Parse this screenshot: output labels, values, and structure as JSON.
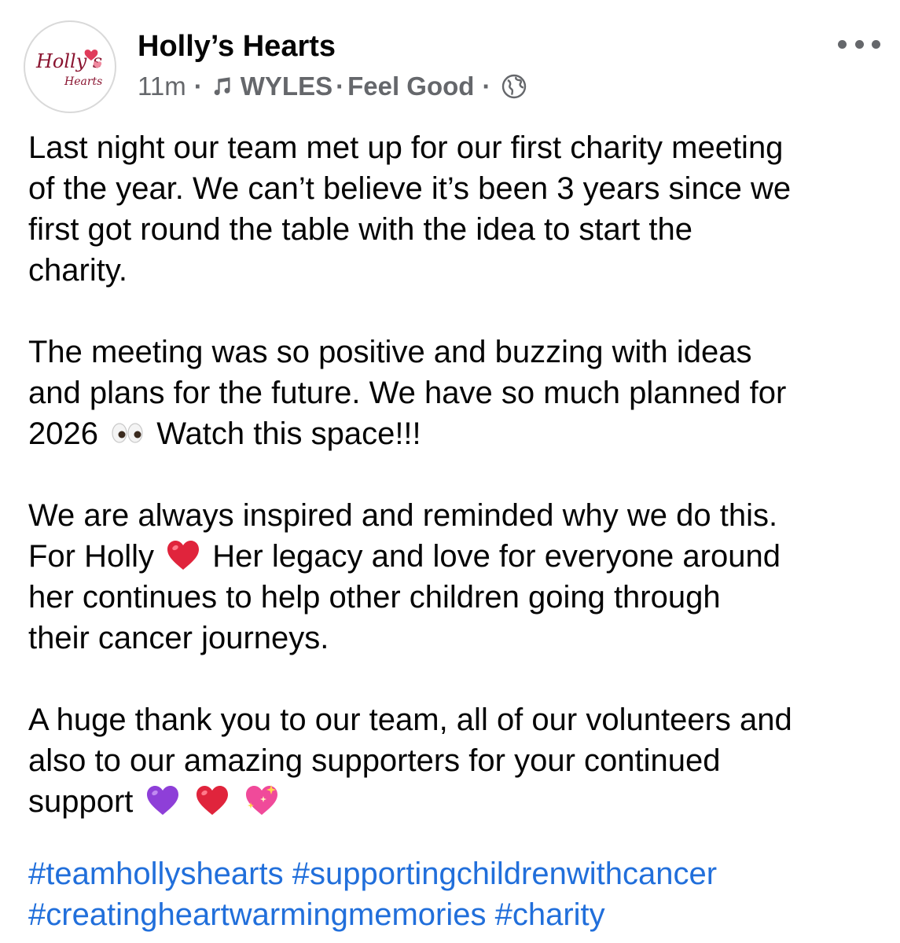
{
  "post": {
    "page_name": "Holly’s Hearts",
    "logo_text": {
      "line1": "Holly’s",
      "line2": "Hearts"
    },
    "time": "11m",
    "music_artist": "WYLES",
    "music_song": "Feel Good",
    "audience_icon": "globe-icon",
    "more_icon": "more-options-icon"
  },
  "body": {
    "p1": {
      "l1": "Last night our team met up for our first charity meeting",
      "l2": "of the year. We can’t believe it’s been 3 years since we",
      "l3": "first got round the table with the idea to start the",
      "l4": "charity."
    },
    "p2": {
      "l1": "The meeting was so positive and buzzing with ideas",
      "l2": "and plans for the future. We have so much planned for",
      "l3a": "2026",
      "l3b": "Watch this space!!!"
    },
    "p3": {
      "l1": "We are always inspired and reminded why we do this.",
      "l2a": "For Holly",
      "l2b": "Her legacy and love for everyone around",
      "l3": "her continues to help other children going through",
      "l4": "their cancer journeys."
    },
    "p4": {
      "l1": "A huge thank you to our team, all of our volunteers and",
      "l2": "also to our amazing supporters for your continued",
      "l3": "support"
    }
  },
  "hashtags": {
    "t1": "#teamhollyshearts",
    "t2": "#supportingchildrenwithcancer",
    "t3": "#creatingheartwarmingmemories",
    "t4": "#charity"
  },
  "colors": {
    "text": "#050505",
    "meta": "#65676b",
    "link": "#216fdb",
    "logo_red": "#c8102e"
  }
}
